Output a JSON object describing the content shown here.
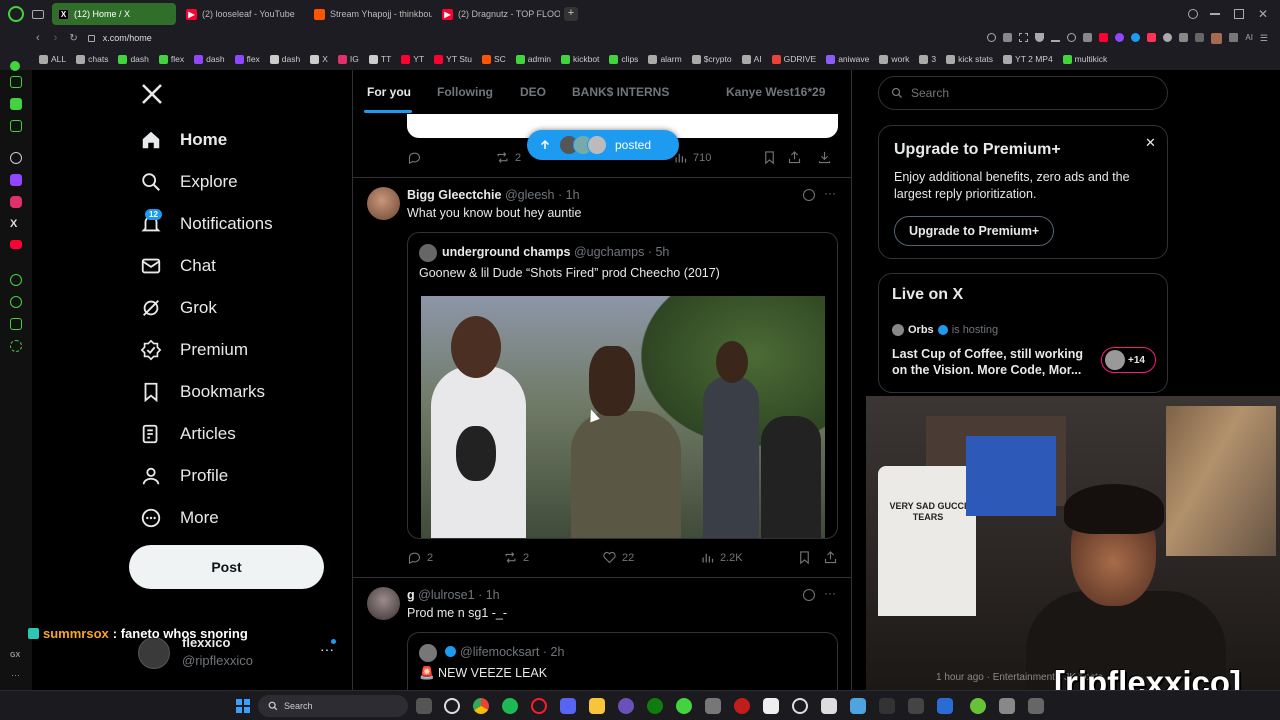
{
  "tabs": [
    {
      "label": "(12) Home / X",
      "color": "#e7e9ea",
      "icon": "x-icon",
      "active": true
    },
    {
      "label": "(2) looseleaf - YouTube",
      "color": "#ff0033",
      "icon": "youtube-icon"
    },
    {
      "label": "Stream Yhapojj - thinkbou",
      "color": "#ff5500",
      "icon": "soundcloud-icon"
    },
    {
      "label": "(2) Dragnutz - TOP FLOOR",
      "color": "#ff0033",
      "icon": "youtube-icon"
    }
  ],
  "url": "x.com/home",
  "bookmarks": [
    {
      "label": "ALL",
      "color": "#aaa"
    },
    {
      "label": "chats",
      "color": "#aaa"
    },
    {
      "label": "dash",
      "color": "#43d33e"
    },
    {
      "label": "flex",
      "color": "#43d33e"
    },
    {
      "label": "dash",
      "color": "#9146ff"
    },
    {
      "label": "flex",
      "color": "#9146ff"
    },
    {
      "label": "dash",
      "color": "#ccc"
    },
    {
      "label": "X",
      "color": "#ccc"
    },
    {
      "label": "IG",
      "color": "#e1306c"
    },
    {
      "label": "TT",
      "color": "#ccc"
    },
    {
      "label": "YT",
      "color": "#ff0033"
    },
    {
      "label": "YT Stu",
      "color": "#ff0033"
    },
    {
      "label": "SC",
      "color": "#ff5500"
    },
    {
      "label": "admin",
      "color": "#43d33e"
    },
    {
      "label": "kickbot",
      "color": "#43d33e"
    },
    {
      "label": "clips",
      "color": "#43d33e"
    },
    {
      "label": "alarm",
      "color": "#aaa"
    },
    {
      "label": "$crypto",
      "color": "#aaa"
    },
    {
      "label": "AI",
      "color": "#aaa"
    },
    {
      "label": "GDRIVE",
      "color": "#ea4335"
    },
    {
      "label": "aniwave",
      "color": "#8b5cf6"
    },
    {
      "label": "work",
      "color": "#aaa"
    },
    {
      "label": "3",
      "color": "#aaa"
    },
    {
      "label": "kick stats",
      "color": "#aaa"
    },
    {
      "label": "YT 2 MP4",
      "color": "#aaa"
    },
    {
      "label": "multikick",
      "color": "#43d33e"
    }
  ],
  "nav": {
    "home": "Home",
    "explore": "Explore",
    "notifications": "Notifications",
    "notif_count": "12",
    "chat": "Chat",
    "grok": "Grok",
    "premium": "Premium",
    "bookmarks": "Bookmarks",
    "articles": "Articles",
    "profile": "Profile",
    "more": "More",
    "post": "Post"
  },
  "account": {
    "name": "flexxico",
    "handle": "@ripflexxico"
  },
  "chat_overlay": {
    "user": "summrsox",
    "message": ": faneto whos snoring"
  },
  "feed_tabs": [
    "For you",
    "Following",
    "DEO",
    "BANK$ INTERNS",
    "Kanye West",
    "16*29"
  ],
  "new_posts_pill": "posted",
  "top_tweet": {
    "retweets": "2",
    "views": "710"
  },
  "tweet1": {
    "name": "Bigg Gleectchie",
    "handle": "@gleesh",
    "time": "· 1h",
    "text": "What you know bout hey auntie",
    "quote": {
      "name": "underground champs",
      "handle": "@ugchamps",
      "time": "· 5h",
      "text": "Goonew & lil Dude “Shots Fired” prod Cheecho (2017)"
    },
    "replies": "2",
    "retweets": "2",
    "likes": "22",
    "views": "2.2K"
  },
  "tweet2": {
    "name": "g",
    "handle": "@lulrose1",
    "time": "· 1h",
    "text": "Prod me n sg1 -_-",
    "quote": {
      "handle": "@lifemocksart",
      "time": "· 2h",
      "text": "🚨 NEW VEEZE LEAK"
    }
  },
  "search_placeholder": "Search",
  "premium_card": {
    "title": "Upgrade to Premium+",
    "body": "Enjoy additional benefits, zero ads and the largest reply prioritization.",
    "button": "Upgrade to Premium+"
  },
  "live": {
    "title": "Live on X",
    "host": "Orbs",
    "hosting": "is hosting",
    "desc": "Last Cup of Coffee, still working on the Vision. More Code, Mor...",
    "extra": "+14"
  },
  "webcam": {
    "watermark": "[ripflexxico]",
    "bottom_text": "1 hour ago · Entertainment · 3K posts",
    "shirt_text": "VERY SAD GUCCI TEARS"
  },
  "taskbar": {
    "search": "Search"
  },
  "colors": {
    "accent": "#1d9bf0",
    "bg": "#000000",
    "border": "#2f3336",
    "muted": "#71767b",
    "live": "#f91880"
  }
}
